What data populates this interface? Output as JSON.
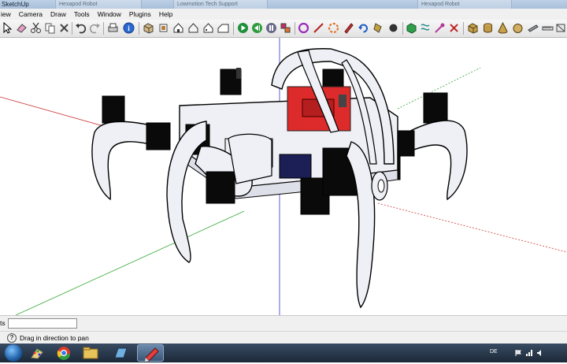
{
  "window": {
    "title": "SketchUp",
    "ghost_tabs": [
      "Hexapod Robot",
      "Lowmotion Tech Support",
      "Hexapod Robot"
    ]
  },
  "menu": {
    "items": [
      "iew",
      "Camera",
      "Draw",
      "Tools",
      "Window",
      "Plugins",
      "Help"
    ]
  },
  "toolbar": {
    "icons": [
      "select-arrow",
      "eraser",
      "cut",
      "copy",
      "paste",
      "delete",
      "undo",
      "redo",
      "print",
      "model-info",
      "iso-view",
      "top-view",
      "front-view",
      "right-view",
      "back-view",
      "left-view",
      "play",
      "previous-scene",
      "next-scene",
      "components",
      "orbit",
      "line",
      "arc",
      "rotate",
      "pencil",
      "paint-bucket",
      "push-pull",
      "follow-me",
      "freehand",
      "tape-measure",
      "eraser-tool",
      "box",
      "cylinder",
      "cone",
      "sphere",
      "dimension",
      "ruler"
    ]
  },
  "status": {
    "measurements_label": "ts",
    "measurements_value": "",
    "hint": "Drag in direction to pan"
  },
  "taskbar": {
    "apps": [
      "paint",
      "chrome",
      "file-explorer",
      "sketchup-layout",
      "sketchup"
    ],
    "language": "DE"
  },
  "colors": {
    "axis_red": "#cc3333",
    "axis_green": "#33a833",
    "axis_blue": "#3333cc",
    "board_red": "#dd2a2a",
    "frame_fill": "#eef0f5",
    "frame_stroke": "#000000",
    "servo_fill": "#0a0a0a"
  }
}
